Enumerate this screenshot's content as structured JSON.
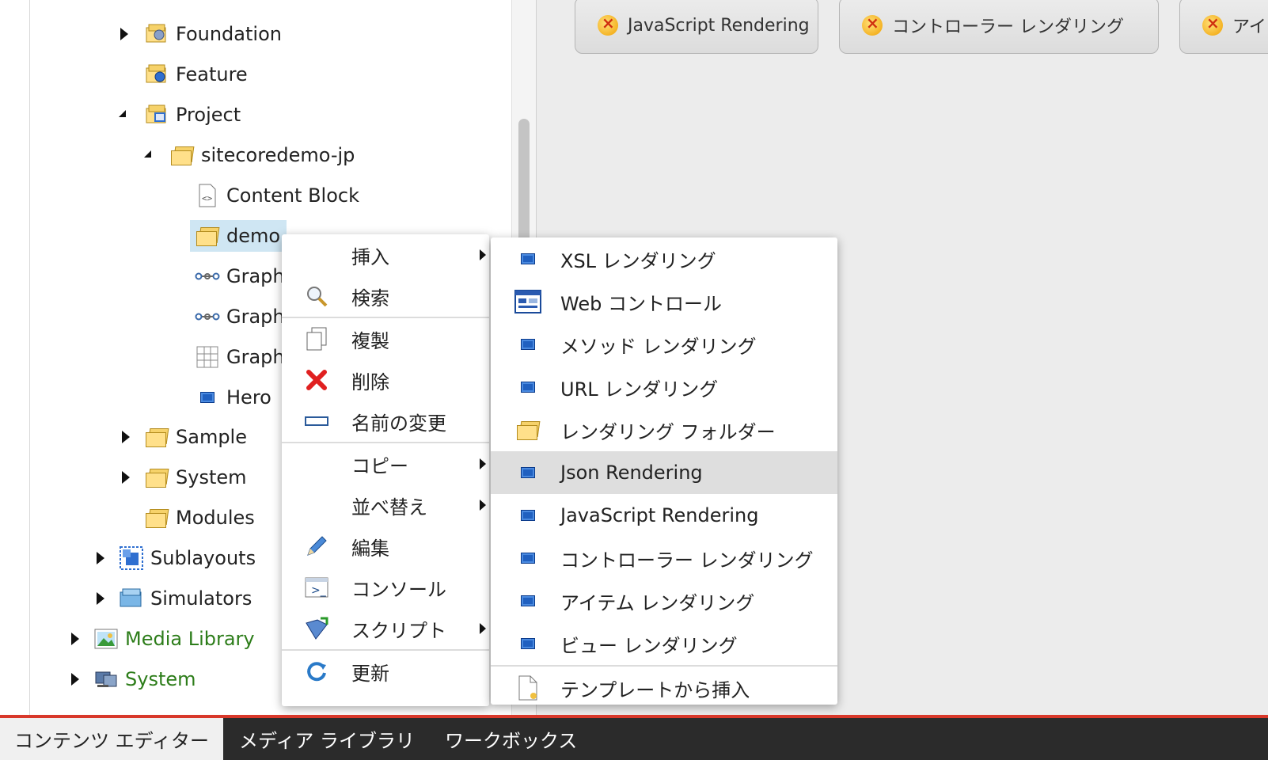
{
  "tree": {
    "items": [
      {
        "label": "Foundation",
        "icon": "foundation-folder-icon"
      },
      {
        "label": "Feature",
        "icon": "feature-folder-icon"
      },
      {
        "label": "Project",
        "icon": "project-folder-icon"
      },
      {
        "label": "sitecoredemo-jp",
        "icon": "folder-icon"
      },
      {
        "label": "Content Block",
        "icon": "code-file-icon"
      },
      {
        "label": "demo",
        "icon": "folder-icon"
      },
      {
        "label": "Graph",
        "icon": "graph-link-icon"
      },
      {
        "label": "Graph",
        "icon": "graph-link-icon"
      },
      {
        "label": "Graph",
        "icon": "grid-icon"
      },
      {
        "label": "Hero",
        "icon": "rendering-icon"
      },
      {
        "label": "Sample",
        "icon": "folder-icon"
      },
      {
        "label": "System",
        "icon": "folder-icon"
      },
      {
        "label": "Modules",
        "icon": "folder-icon"
      },
      {
        "label": "Sublayouts",
        "icon": "sublayouts-icon"
      },
      {
        "label": "Simulators",
        "icon": "simulators-folder-icon"
      },
      {
        "label": "Media Library",
        "icon": "media-library-icon"
      },
      {
        "label": "System",
        "icon": "system-icon"
      }
    ]
  },
  "right_tabs": [
    {
      "label": "JavaScript Rendering"
    },
    {
      "label": "コントローラー レンダリング"
    },
    {
      "label": "アイ"
    }
  ],
  "context_menu": {
    "items": [
      {
        "label": "挿入"
      },
      {
        "label": "検索"
      },
      {
        "label": "複製"
      },
      {
        "label": "削除"
      },
      {
        "label": "名前の変更"
      },
      {
        "label": "コピー"
      },
      {
        "label": "並べ替え"
      },
      {
        "label": "編集"
      },
      {
        "label": "コンソール"
      },
      {
        "label": "スクリプト"
      },
      {
        "label": "更新"
      }
    ]
  },
  "insert_submenu": {
    "items": [
      {
        "label": "XSL レンダリング"
      },
      {
        "label": "Web コントロール"
      },
      {
        "label": "メソッド レンダリング"
      },
      {
        "label": "URL レンダリング"
      },
      {
        "label": "レンダリング フォルダー"
      },
      {
        "label": "Json Rendering"
      },
      {
        "label": "JavaScript Rendering"
      },
      {
        "label": "コントローラー レンダリング"
      },
      {
        "label": "アイテム レンダリング"
      },
      {
        "label": "ビュー レンダリング"
      },
      {
        "label": "テンプレートから挿入"
      }
    ]
  },
  "bottom_tabs": [
    {
      "label": "コンテンツ エディター"
    },
    {
      "label": "メディア ライブラリ"
    },
    {
      "label": "ワークボックス"
    }
  ],
  "colors": {
    "accent_red": "#d8382a",
    "selected_bg": "#cfe6f3",
    "green_text": "#2d7d1a"
  }
}
